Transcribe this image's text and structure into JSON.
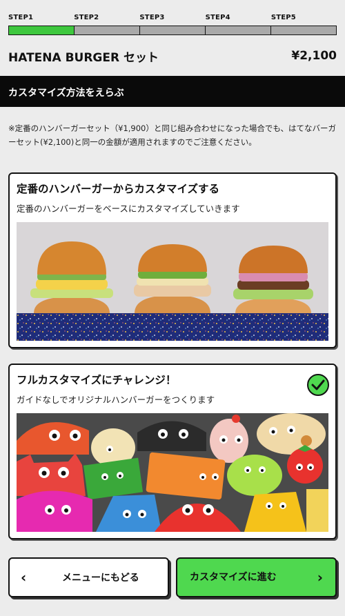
{
  "stepper": {
    "steps": [
      "STEP1",
      "STEP2",
      "STEP3",
      "STEP4",
      "STEP5"
    ],
    "active_step": 1,
    "active_color": "#3ec73e",
    "inactive_color": "#a9a9a9"
  },
  "set": {
    "title": "HATENA BURGER セット",
    "price": "¥2,100"
  },
  "section": {
    "heading": "カスタマイズ方法をえらぶ"
  },
  "note": "※定番のハンバーガーセット（¥1,900）と同じ組み合わせになった場合でも、はてなバーガーセット(¥2,100)と同一の金額が適用されますのでご注意ください。",
  "options": [
    {
      "title": "定番のハンバーガーからカスタマイズする",
      "description": "定番のハンバーガーをベースにカスタマイズしていきます",
      "image": "three-burgers-photo",
      "selected": false
    },
    {
      "title": "フルカスタマイズにチャレンジ！",
      "description": "ガイドなしでオリジナルハンバーガーをつくります",
      "image": "ingredient-characters-illustration",
      "selected": true,
      "check_icon": "check-circle-icon"
    }
  ],
  "footer": {
    "back_label": "メニューにもどる",
    "next_label": "カスタマイズに進む",
    "back_icon": "chevron-left-icon",
    "next_icon": "chevron-right-icon",
    "next_color": "#4fd84f"
  }
}
